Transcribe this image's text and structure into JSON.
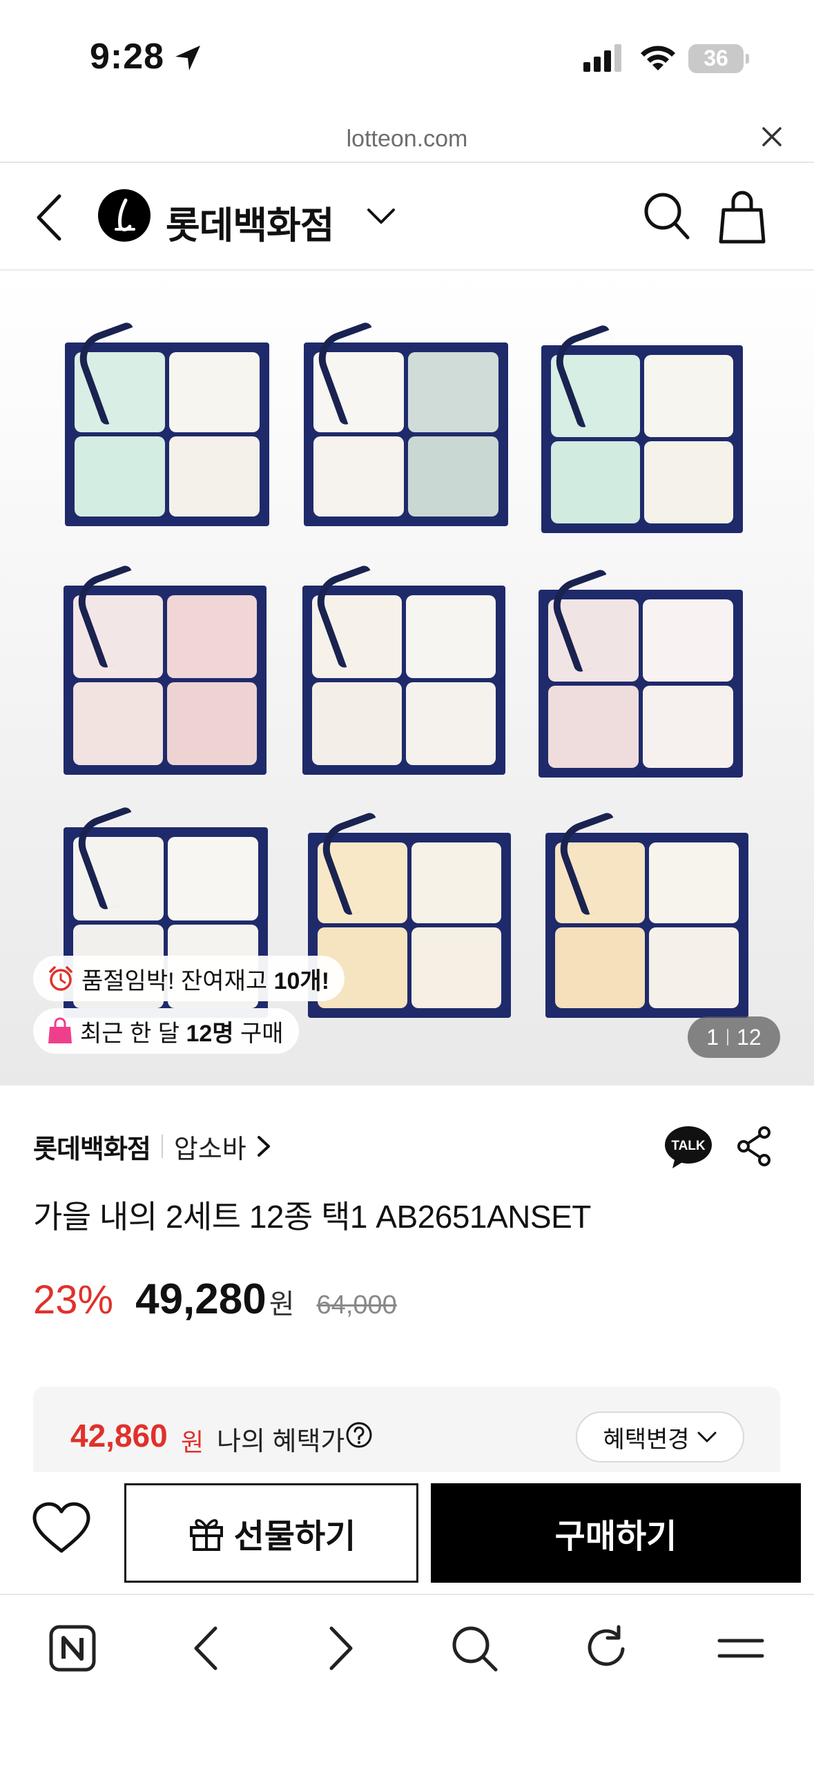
{
  "status_bar": {
    "time": "9:28",
    "battery": "36"
  },
  "browser": {
    "url": "lotteon.com"
  },
  "header": {
    "brand_name": "롯데백화점"
  },
  "gallery": {
    "stock_badge": {
      "prefix": "품절임박! 잔여재고 ",
      "count": "10개!"
    },
    "sales_badge": {
      "prefix": "최근 한 달 ",
      "count": "12명",
      "suffix": " 구매"
    },
    "page_current": "1",
    "page_total": "12"
  },
  "product": {
    "seller": "롯데백화점",
    "brand": "압소바",
    "title": "가을 내의 2세트 12종 택1 AB2651ANSET",
    "discount": "23%",
    "sale_price": "49,280",
    "won": "원",
    "original_price": "64,000"
  },
  "benefit": {
    "price": "42,860",
    "won": "원",
    "label": "나의 혜택가",
    "change_button": "혜택변경"
  },
  "actions": {
    "gift_label": "선물하기",
    "buy_label": "구매하기"
  },
  "icons": {
    "talk_icon_text": "TALK"
  },
  "colors": {
    "accent_red": "#e0312b",
    "box_navy": "#1f2a6b",
    "buy_bg": "#000000"
  }
}
